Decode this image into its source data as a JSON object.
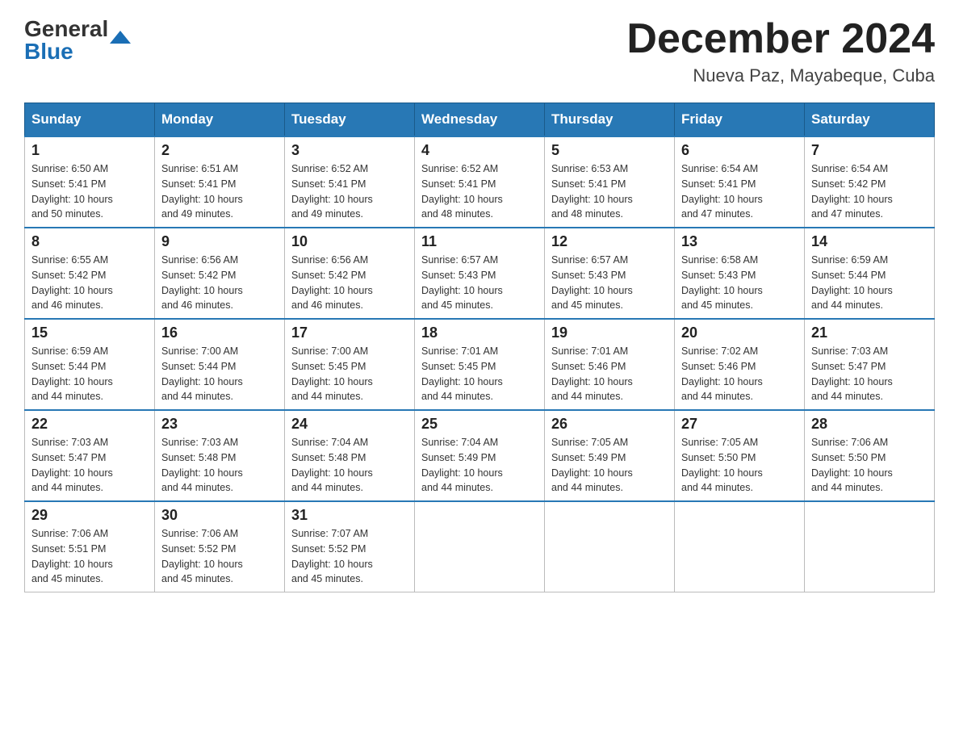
{
  "header": {
    "logo_general": "General",
    "logo_blue": "Blue",
    "month": "December 2024",
    "location": "Nueva Paz, Mayabeque, Cuba"
  },
  "weekdays": [
    "Sunday",
    "Monday",
    "Tuesday",
    "Wednesday",
    "Thursday",
    "Friday",
    "Saturday"
  ],
  "weeks": [
    [
      {
        "day": "1",
        "sunrise": "6:50 AM",
        "sunset": "5:41 PM",
        "daylight": "10 hours and 50 minutes."
      },
      {
        "day": "2",
        "sunrise": "6:51 AM",
        "sunset": "5:41 PM",
        "daylight": "10 hours and 49 minutes."
      },
      {
        "day": "3",
        "sunrise": "6:52 AM",
        "sunset": "5:41 PM",
        "daylight": "10 hours and 49 minutes."
      },
      {
        "day": "4",
        "sunrise": "6:52 AM",
        "sunset": "5:41 PM",
        "daylight": "10 hours and 48 minutes."
      },
      {
        "day": "5",
        "sunrise": "6:53 AM",
        "sunset": "5:41 PM",
        "daylight": "10 hours and 48 minutes."
      },
      {
        "day": "6",
        "sunrise": "6:54 AM",
        "sunset": "5:41 PM",
        "daylight": "10 hours and 47 minutes."
      },
      {
        "day": "7",
        "sunrise": "6:54 AM",
        "sunset": "5:42 PM",
        "daylight": "10 hours and 47 minutes."
      }
    ],
    [
      {
        "day": "8",
        "sunrise": "6:55 AM",
        "sunset": "5:42 PM",
        "daylight": "10 hours and 46 minutes."
      },
      {
        "day": "9",
        "sunrise": "6:56 AM",
        "sunset": "5:42 PM",
        "daylight": "10 hours and 46 minutes."
      },
      {
        "day": "10",
        "sunrise": "6:56 AM",
        "sunset": "5:42 PM",
        "daylight": "10 hours and 46 minutes."
      },
      {
        "day": "11",
        "sunrise": "6:57 AM",
        "sunset": "5:43 PM",
        "daylight": "10 hours and 45 minutes."
      },
      {
        "day": "12",
        "sunrise": "6:57 AM",
        "sunset": "5:43 PM",
        "daylight": "10 hours and 45 minutes."
      },
      {
        "day": "13",
        "sunrise": "6:58 AM",
        "sunset": "5:43 PM",
        "daylight": "10 hours and 45 minutes."
      },
      {
        "day": "14",
        "sunrise": "6:59 AM",
        "sunset": "5:44 PM",
        "daylight": "10 hours and 44 minutes."
      }
    ],
    [
      {
        "day": "15",
        "sunrise": "6:59 AM",
        "sunset": "5:44 PM",
        "daylight": "10 hours and 44 minutes."
      },
      {
        "day": "16",
        "sunrise": "7:00 AM",
        "sunset": "5:44 PM",
        "daylight": "10 hours and 44 minutes."
      },
      {
        "day": "17",
        "sunrise": "7:00 AM",
        "sunset": "5:45 PM",
        "daylight": "10 hours and 44 minutes."
      },
      {
        "day": "18",
        "sunrise": "7:01 AM",
        "sunset": "5:45 PM",
        "daylight": "10 hours and 44 minutes."
      },
      {
        "day": "19",
        "sunrise": "7:01 AM",
        "sunset": "5:46 PM",
        "daylight": "10 hours and 44 minutes."
      },
      {
        "day": "20",
        "sunrise": "7:02 AM",
        "sunset": "5:46 PM",
        "daylight": "10 hours and 44 minutes."
      },
      {
        "day": "21",
        "sunrise": "7:03 AM",
        "sunset": "5:47 PM",
        "daylight": "10 hours and 44 minutes."
      }
    ],
    [
      {
        "day": "22",
        "sunrise": "7:03 AM",
        "sunset": "5:47 PM",
        "daylight": "10 hours and 44 minutes."
      },
      {
        "day": "23",
        "sunrise": "7:03 AM",
        "sunset": "5:48 PM",
        "daylight": "10 hours and 44 minutes."
      },
      {
        "day": "24",
        "sunrise": "7:04 AM",
        "sunset": "5:48 PM",
        "daylight": "10 hours and 44 minutes."
      },
      {
        "day": "25",
        "sunrise": "7:04 AM",
        "sunset": "5:49 PM",
        "daylight": "10 hours and 44 minutes."
      },
      {
        "day": "26",
        "sunrise": "7:05 AM",
        "sunset": "5:49 PM",
        "daylight": "10 hours and 44 minutes."
      },
      {
        "day": "27",
        "sunrise": "7:05 AM",
        "sunset": "5:50 PM",
        "daylight": "10 hours and 44 minutes."
      },
      {
        "day": "28",
        "sunrise": "7:06 AM",
        "sunset": "5:50 PM",
        "daylight": "10 hours and 44 minutes."
      }
    ],
    [
      {
        "day": "29",
        "sunrise": "7:06 AM",
        "sunset": "5:51 PM",
        "daylight": "10 hours and 45 minutes."
      },
      {
        "day": "30",
        "sunrise": "7:06 AM",
        "sunset": "5:52 PM",
        "daylight": "10 hours and 45 minutes."
      },
      {
        "day": "31",
        "sunrise": "7:07 AM",
        "sunset": "5:52 PM",
        "daylight": "10 hours and 45 minutes."
      },
      null,
      null,
      null,
      null
    ]
  ],
  "labels": {
    "sunrise": "Sunrise:",
    "sunset": "Sunset:",
    "daylight": "Daylight:"
  }
}
